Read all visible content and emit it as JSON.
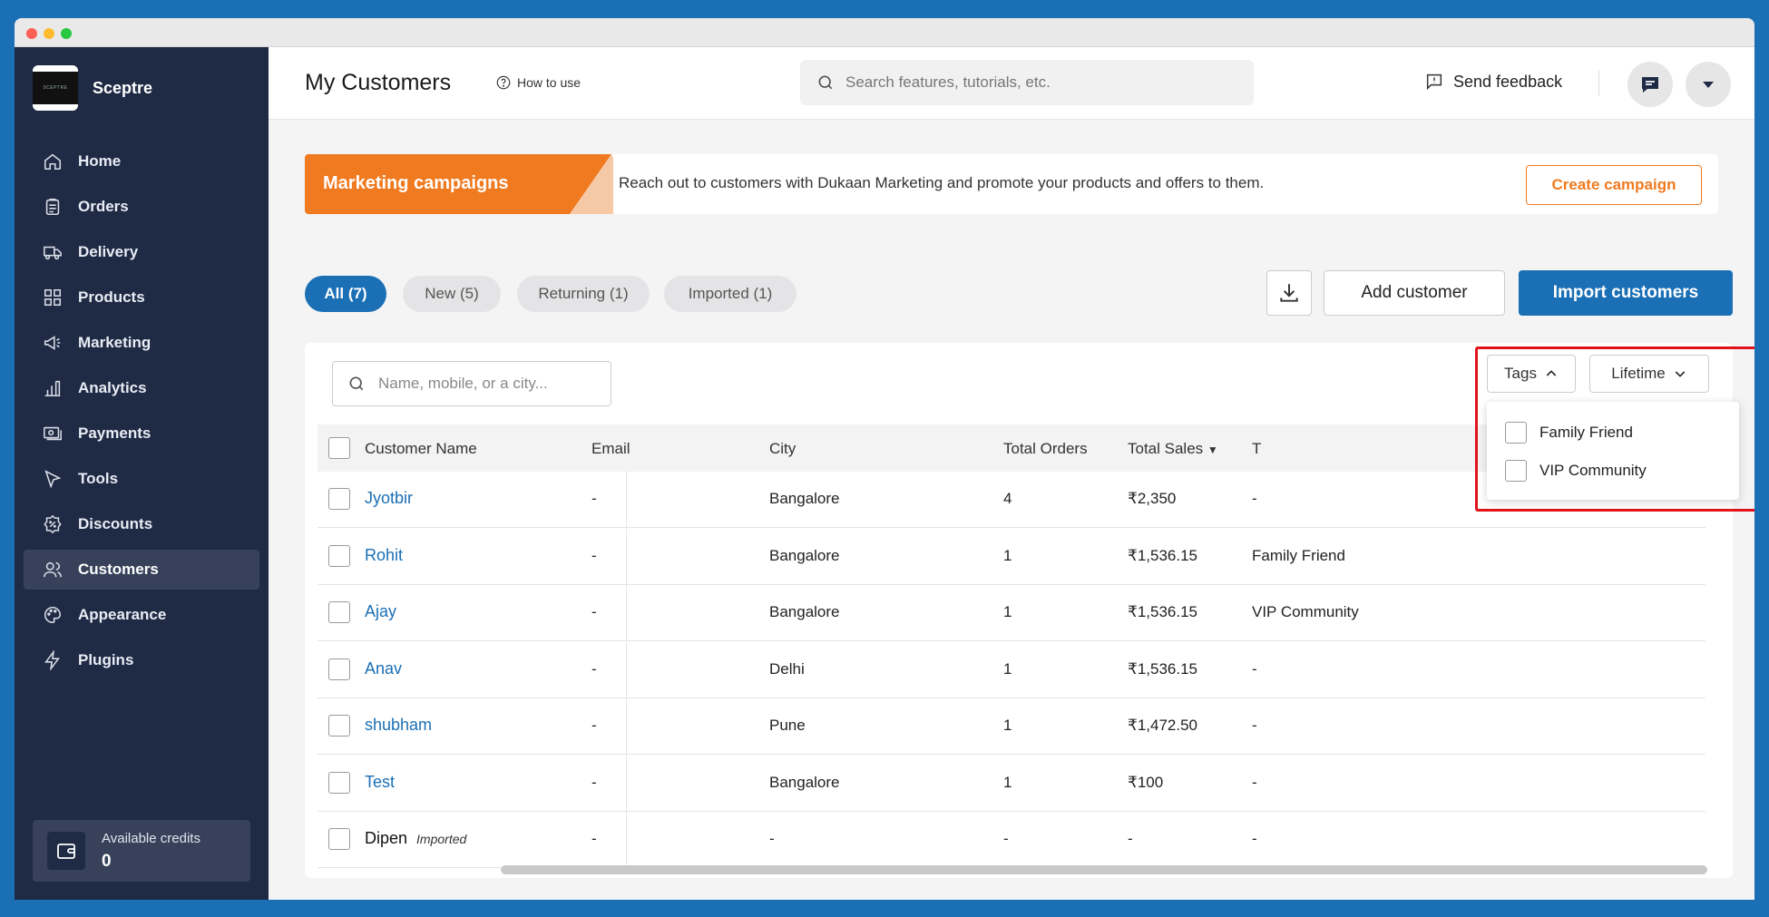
{
  "brand": {
    "name": "Sceptre",
    "logo_text": "SCEPTRE"
  },
  "sidebar": {
    "items": [
      {
        "label": "Home",
        "icon": "home-icon"
      },
      {
        "label": "Orders",
        "icon": "orders-icon"
      },
      {
        "label": "Delivery",
        "icon": "truck-icon"
      },
      {
        "label": "Products",
        "icon": "grid-icon"
      },
      {
        "label": "Marketing",
        "icon": "megaphone-icon"
      },
      {
        "label": "Analytics",
        "icon": "bar-chart-icon"
      },
      {
        "label": "Payments",
        "icon": "payments-icon"
      },
      {
        "label": "Tools",
        "icon": "cursor-icon"
      },
      {
        "label": "Discounts",
        "icon": "discount-badge-icon"
      },
      {
        "label": "Customers",
        "icon": "users-icon",
        "active": true
      },
      {
        "label": "Appearance",
        "icon": "palette-icon"
      },
      {
        "label": "Plugins",
        "icon": "lightning-icon"
      }
    ],
    "credits": {
      "label": "Available credits",
      "value": "0"
    }
  },
  "topbar": {
    "title": "My Customers",
    "how_to_use": "How to use",
    "search_placeholder": "Search features, tutorials, etc.",
    "feedback": "Send feedback"
  },
  "banner": {
    "tag": "Marketing campaigns",
    "text": "Reach out to customers with Dukaan Marketing and promote your products and offers to them.",
    "button": "Create campaign"
  },
  "filters": {
    "pills": [
      "All (7)",
      "New (5)",
      "Returning (1)",
      "Imported (1)"
    ],
    "add_customer": "Add customer",
    "import_customers": "Import customers"
  },
  "table": {
    "search_placeholder": "Name, mobile, or a city...",
    "columns": [
      "Customer Name",
      "Email",
      "City",
      "Total Orders",
      "Total Sales",
      "T"
    ],
    "rows": [
      {
        "name": "Jyotbir",
        "email": "-",
        "city": "Bangalore",
        "orders": "4",
        "sales": "₹2,350",
        "tags": "-"
      },
      {
        "name": "Rohit",
        "email": "-",
        "city": "Bangalore",
        "orders": "1",
        "sales": "₹1,536.15",
        "tags": "Family Friend"
      },
      {
        "name": "Ajay",
        "email": "-",
        "city": "Bangalore",
        "orders": "1",
        "sales": "₹1,536.15",
        "tags": "VIP Community"
      },
      {
        "name": "Anav",
        "email": "-",
        "city": "Delhi",
        "orders": "1",
        "sales": "₹1,536.15",
        "tags": "-"
      },
      {
        "name": "shubham",
        "email": "-",
        "city": "Pune",
        "orders": "1",
        "sales": "₹1,472.50",
        "tags": "-"
      },
      {
        "name": "Test",
        "email": "-",
        "city": "Bangalore",
        "orders": "1",
        "sales": "₹100",
        "tags": "-"
      },
      {
        "name": "Dipen",
        "badge": "Imported",
        "email": "-",
        "city": "-",
        "orders": "-",
        "sales": "-",
        "tags": "-"
      }
    ]
  },
  "dropdown": {
    "tags_label": "Tags",
    "lifetime_label": "Lifetime",
    "options": [
      "Family Friend",
      "VIP Community"
    ]
  },
  "colors": {
    "accent": "#1a6fb5",
    "sidebar": "#1f2a44",
    "orange": "#f07a1f",
    "highlight": "#e0131a"
  }
}
